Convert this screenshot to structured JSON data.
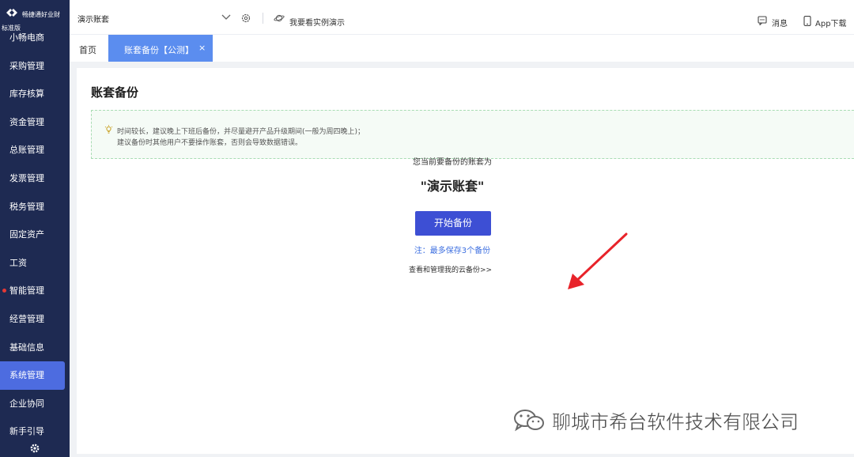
{
  "sidebar": {
    "brand_name": "畅捷通好业财",
    "brand_tier": "标准版",
    "items": [
      {
        "label": "小畅电商"
      },
      {
        "label": "采购管理"
      },
      {
        "label": "库存核算"
      },
      {
        "label": "资金管理"
      },
      {
        "label": "总账管理"
      },
      {
        "label": "发票管理"
      },
      {
        "label": "税务管理"
      },
      {
        "label": "固定资产"
      },
      {
        "label": "工资"
      },
      {
        "label": "智能管理"
      },
      {
        "label": "经营管理"
      },
      {
        "label": "基础信息"
      },
      {
        "label": "系统管理"
      },
      {
        "label": "企业协同"
      },
      {
        "label": "新手引导"
      }
    ],
    "active_index": 12,
    "dot_index": 9
  },
  "topbar": {
    "account": "演示账套",
    "demo_link": "我要看实例演示",
    "messages": "消息",
    "app_download": "App下载"
  },
  "tabs": {
    "home": "首页",
    "active": "账套备份【公测】",
    "close": "×"
  },
  "page": {
    "title": "账套备份",
    "notice_line1": "时间较长，建议晚上下班后备份，并尽量避开产品升级期间(一般为周四晚上)；",
    "notice_line2": "建议备份时其他用户不要操作账套，否则会导致数据错误。",
    "current_label": "您当前要备份的账套为",
    "account_name": "\"演示账套\"",
    "start_button": "开始备份",
    "note": "注：最多保存3个备份",
    "cloud_link": "查看和管理我的云备份>>"
  },
  "watermark": {
    "text": "聊城市希台软件技术有限公司"
  },
  "colors": {
    "sidebar_bg": "#1e2a52",
    "active_menu": "#4d6ce0",
    "tab_active": "#5b8def",
    "primary_button": "#3d4fd4",
    "note_blue": "#3d6fe0",
    "arrow_red": "#e8232a"
  }
}
